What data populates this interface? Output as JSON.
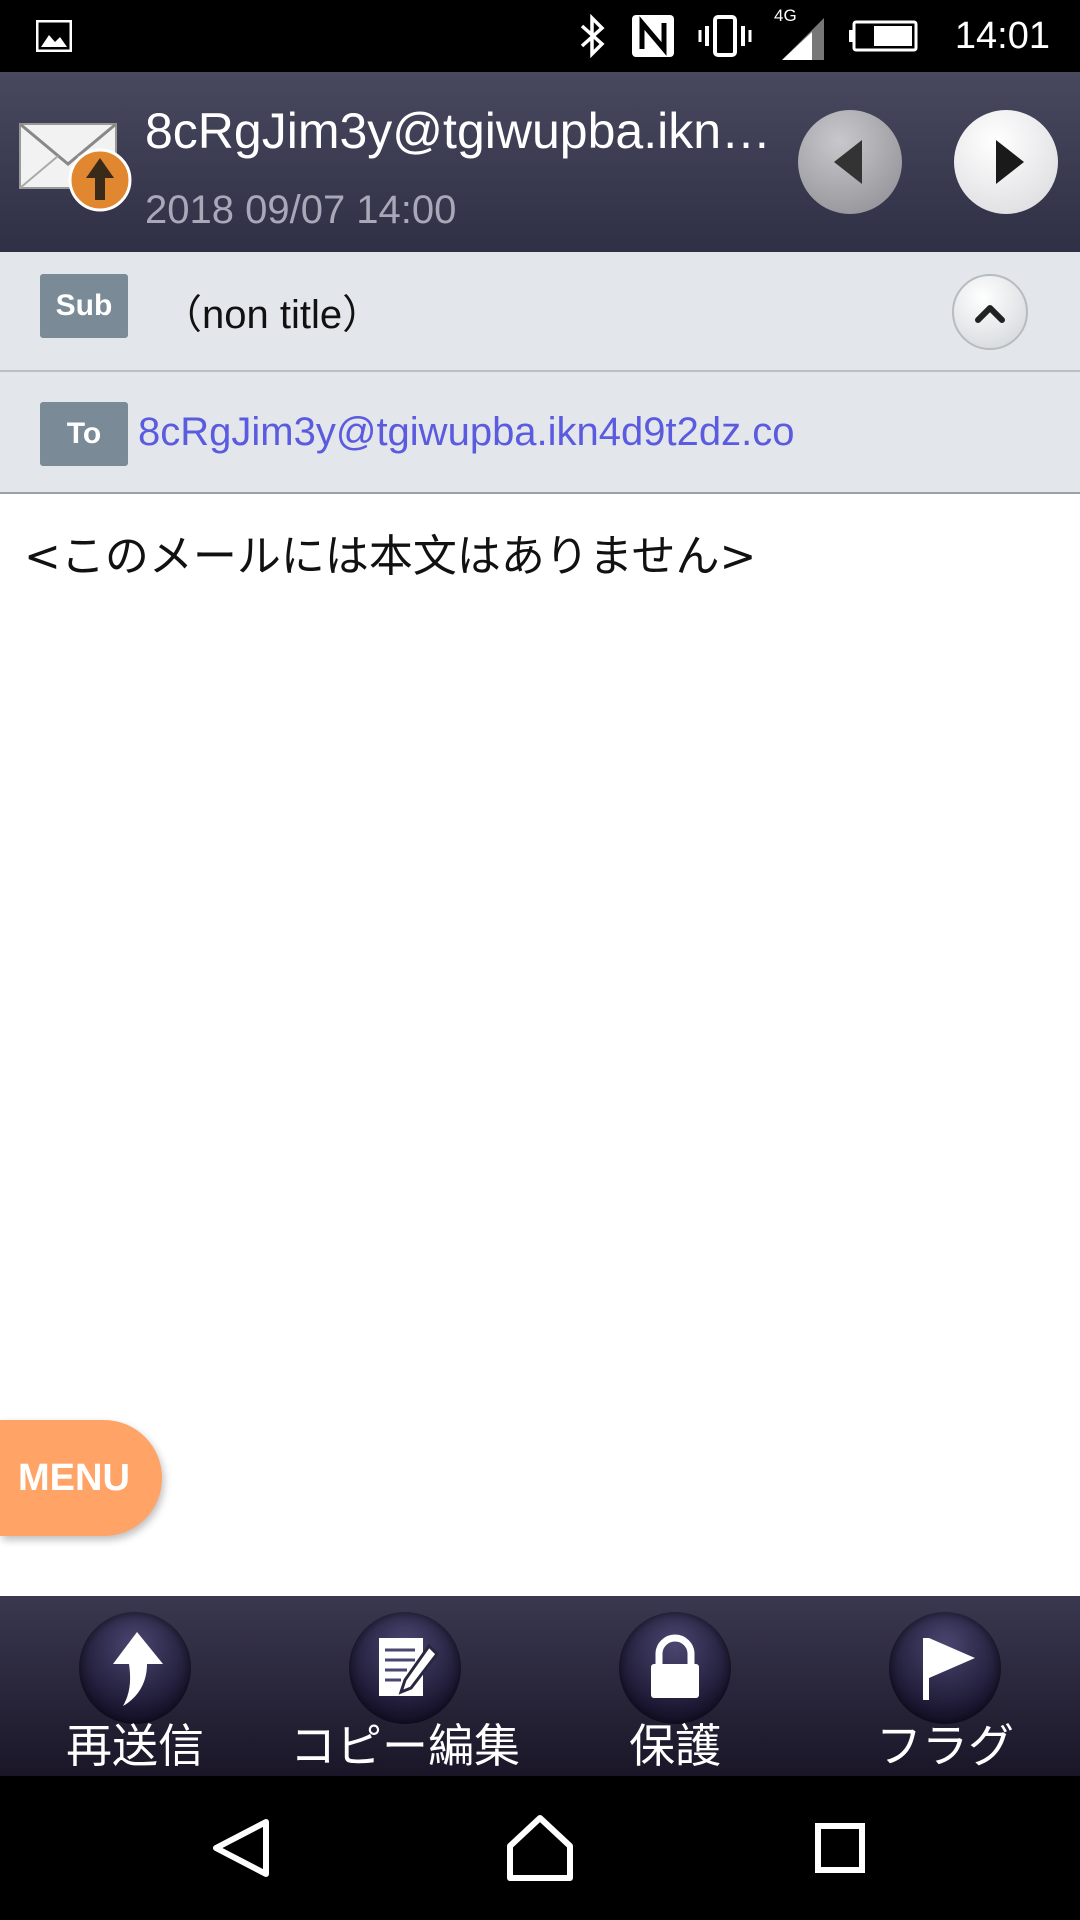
{
  "status_bar": {
    "time": "14:01",
    "network": "4G",
    "icons": [
      "gallery-icon",
      "bluetooth-icon",
      "nfc-icon",
      "vibrate-icon",
      "signal-icon",
      "battery-icon"
    ]
  },
  "header": {
    "sender": "8cRgJim3y@tgiwupba.ikn4d9t2dz.co",
    "date": "2018 09/07 14:00",
    "icons": [
      "sent-mail-icon",
      "previous-icon",
      "next-icon"
    ]
  },
  "mail": {
    "sub_label": "Sub",
    "subject": "（non title）",
    "to_label": "To",
    "to_address": "8cRgJim3y@tgiwupba.ikn4d9t2dz.co",
    "body": "<このメールには本文はありません>"
  },
  "menu": {
    "label": "MENU",
    "color": "#ffa466"
  },
  "toolbar": {
    "resend": "再送信",
    "copy_edit": "コピー編集",
    "protect": "保護",
    "flag": "フラグ"
  },
  "colors": {
    "header_bg": "#3a3a52",
    "info_bg": "#e3e7eb",
    "badge_bg": "#7a8b97",
    "link": "#5b5be0"
  }
}
